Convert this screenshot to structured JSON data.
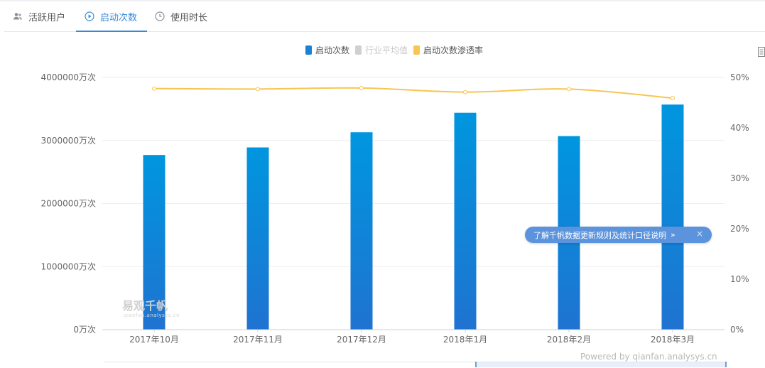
{
  "tabs": [
    {
      "label": "活跃用户",
      "icon": "users-icon",
      "active": false
    },
    {
      "label": "启动次数",
      "icon": "play-circle-icon",
      "active": true
    },
    {
      "label": "使用时长",
      "icon": "clock-icon",
      "active": false
    }
  ],
  "colors": {
    "bar_top": "#0096df",
    "bar_bottom": "#1f73d0",
    "line": "#f7c552",
    "grid": "#eeeeee",
    "accent": "#3a8ad8"
  },
  "tooltip": {
    "text": "了解千帆数据更新规则及统计口径说明",
    "chevron": "»",
    "close": "×"
  },
  "watermark": {
    "title": "易观千帆",
    "subtitle": "qianfan.analysys.cn"
  },
  "powered_by": "Powered by qianfan.analysys.cn",
  "chart_data": {
    "type": "bar",
    "title": "",
    "categories": [
      "2017年10月",
      "2017年11月",
      "2017年12月",
      "2018年1月",
      "2018年2月",
      "2018年3月"
    ],
    "legend_position": "top-center",
    "grid": true,
    "series": [
      {
        "name": "启动次数",
        "type": "bar",
        "axis": "left",
        "enabled": true,
        "values": [
          2770000,
          2890000,
          3130000,
          3440000,
          3070000,
          3570000
        ]
      },
      {
        "name": "行业平均值",
        "type": "bar",
        "axis": "left",
        "enabled": false,
        "values": []
      },
      {
        "name": "启动次数渗透率",
        "type": "line",
        "axis": "right",
        "enabled": true,
        "values": [
          0.478,
          0.477,
          0.479,
          0.471,
          0.477,
          0.459
        ]
      }
    ],
    "y_left": {
      "min": 0,
      "max": 4000000,
      "ticks": [
        0,
        1000000,
        2000000,
        3000000,
        4000000
      ],
      "tick_labels": [
        "0万次",
        "1000000万次",
        "2000000万次",
        "3000000万次",
        "4000000万次"
      ]
    },
    "y_right": {
      "min": 0,
      "max": 0.5,
      "ticks": [
        0,
        0.1,
        0.2,
        0.3,
        0.4,
        0.5
      ],
      "tick_labels": [
        "0%",
        "10%",
        "20%",
        "30%",
        "40%",
        "50%"
      ]
    }
  }
}
